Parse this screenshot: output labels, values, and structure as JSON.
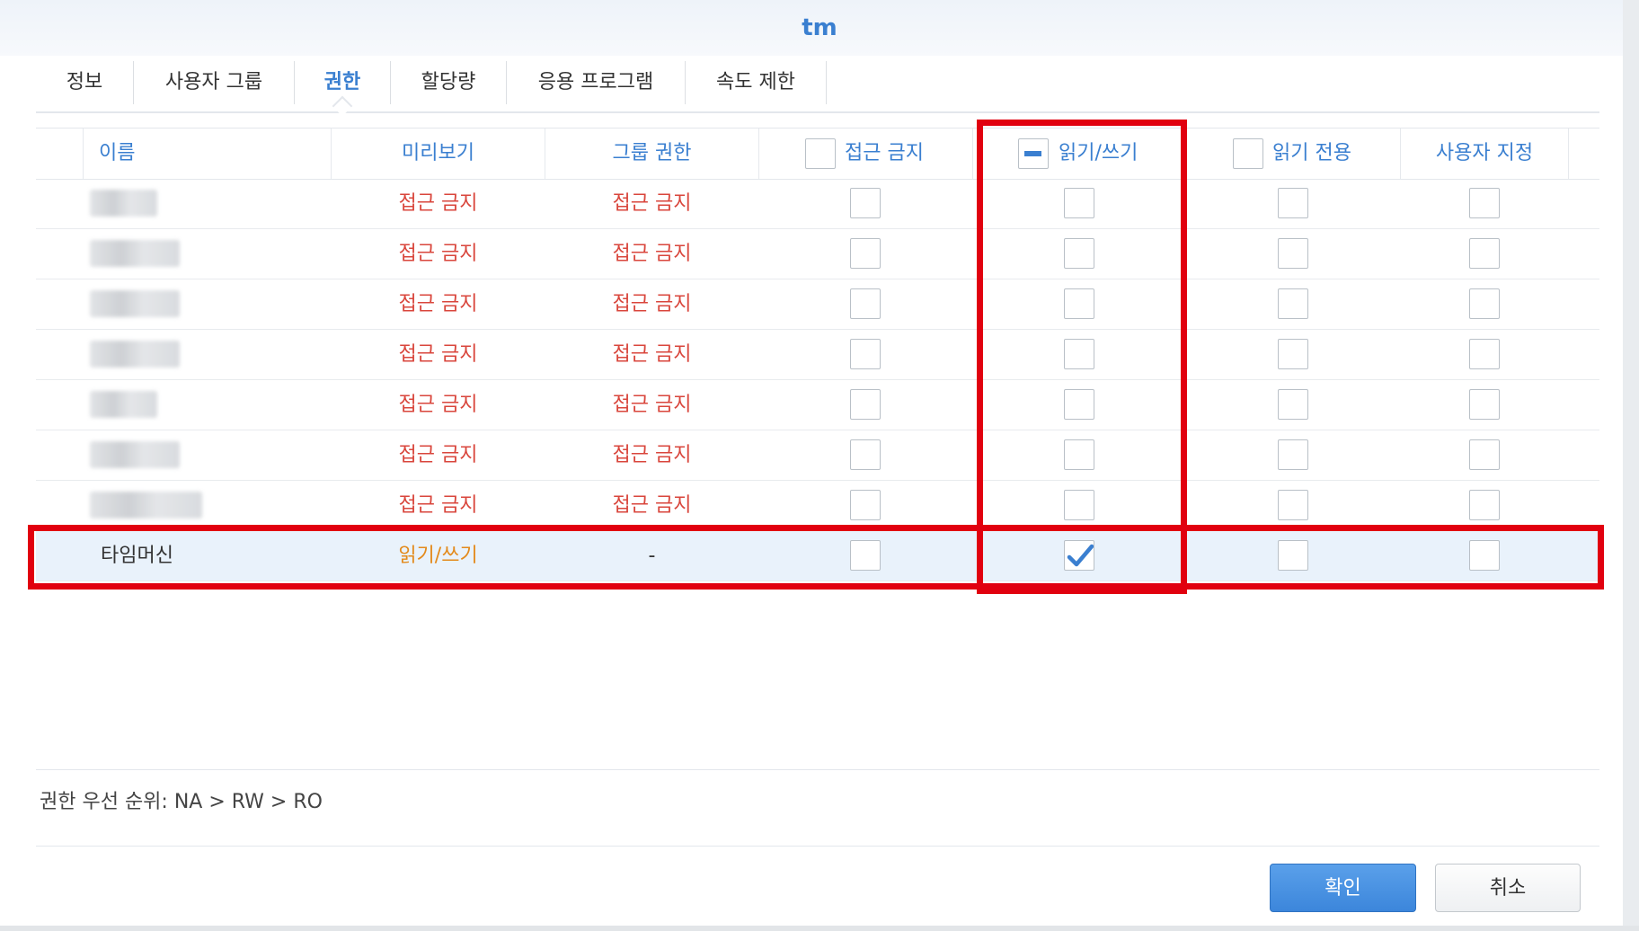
{
  "window": {
    "title": "tm"
  },
  "tabs": [
    {
      "label": "정보"
    },
    {
      "label": "사용자 그룹"
    },
    {
      "label": "권한",
      "active": true
    },
    {
      "label": "할당량"
    },
    {
      "label": "응용 프로그램"
    },
    {
      "label": "속도 제한"
    }
  ],
  "table": {
    "headers": {
      "name": "이름",
      "preview": "미리보기",
      "group_permission": "그룹 권한",
      "no_access": "접근 금지",
      "read_write": "읽기/쓰기",
      "read_only": "읽기 전용",
      "custom": "사용자 지정"
    },
    "header_checkbox_state": {
      "no_access": "unchecked",
      "read_write": "indeterminate",
      "read_only": "unchecked"
    },
    "rows": [
      {
        "name": "",
        "preview": "접근 금지",
        "group": "접근 금지",
        "na": false,
        "rw": false,
        "ro": false,
        "custom": false
      },
      {
        "name": "",
        "preview": "접근 금지",
        "group": "접근 금지",
        "na": false,
        "rw": false,
        "ro": false,
        "custom": false
      },
      {
        "name": "",
        "preview": "접근 금지",
        "group": "접근 금지",
        "na": false,
        "rw": false,
        "ro": false,
        "custom": false
      },
      {
        "name": "",
        "preview": "접근 금지",
        "group": "접근 금지",
        "na": false,
        "rw": false,
        "ro": false,
        "custom": false
      },
      {
        "name": "",
        "preview": "접근 금지",
        "group": "접근 금지",
        "na": false,
        "rw": false,
        "ro": false,
        "custom": false
      },
      {
        "name": "",
        "preview": "접근 금지",
        "group": "접근 금지",
        "na": false,
        "rw": false,
        "ro": false,
        "custom": false
      },
      {
        "name": "",
        "preview": "접근 금지",
        "group": "접근 금지",
        "na": false,
        "rw": false,
        "ro": false,
        "custom": false
      },
      {
        "name": "타임머신",
        "preview": "읽기/쓰기",
        "group": "-",
        "na": false,
        "rw": true,
        "ro": false,
        "custom": false,
        "selected": true
      }
    ]
  },
  "footer": {
    "priority_text": "권한 우선 순위: NA > RW > RO",
    "ok_label": "확인",
    "cancel_label": "취소"
  },
  "colors": {
    "accent": "#3a7fd0",
    "deny": "#d9463c",
    "rw": "#e38a1b",
    "highlight": "#e1000f",
    "selected_row": "#e9f2fb"
  }
}
